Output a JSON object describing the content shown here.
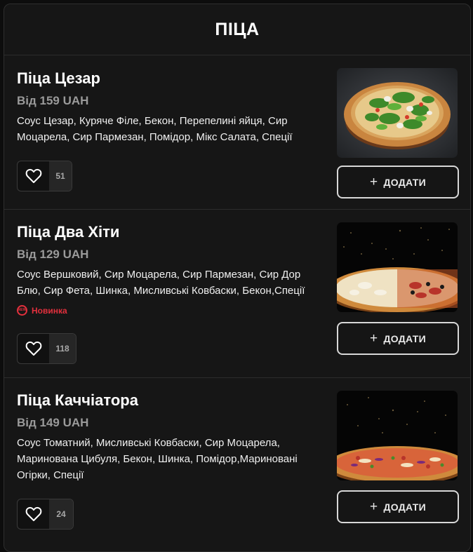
{
  "header": {
    "title": "ПІЦА"
  },
  "items": [
    {
      "name": "Піца Цезар",
      "price": "Від 159 UAH",
      "description": "Соус Цезар, Куряче Філе, Бекон, Перепелині яйця, Сир Моцарела, Сир Пармезан, Помідор, Мікс Салата, Спеції",
      "likes": "51",
      "add_label": "ДОДАТИ"
    },
    {
      "name": "Піца Два Хіти",
      "price": "Від 129 UAH",
      "description": "Соус Вершковий, Сир Моцарела, Сир Пармезан, Сир Дор Блю, Сир Фета, Шинка, Мисливські Ковбаски, Бекон,Спеції",
      "badge": "Новинка",
      "badge_icon_text": "NEW",
      "likes": "118",
      "add_label": "ДОДАТИ"
    },
    {
      "name": "Піца Каччіатора",
      "price": "Від 149 UAH",
      "description": "Соус Томатний, Мисливські Ковбаски, Сир Моцарела, Маринована Цибуля, Бекон, Шинка, Помідор,Мариновані Огірки, Спеції",
      "likes": "24",
      "add_label": "ДОДАТИ"
    }
  ],
  "colors": {
    "accent_new": "#e3303d",
    "background": "#161616",
    "button_border": "#d8d8d8"
  }
}
